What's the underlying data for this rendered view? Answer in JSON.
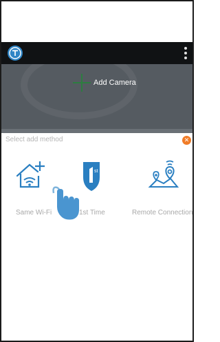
{
  "header": {
    "add_camera_label": "Add Camera"
  },
  "sheet": {
    "title": "Select add method",
    "close_icon": "close-x",
    "methods": [
      {
        "label": "Same Wi-Fi",
        "icon": "home-plus-icon"
      },
      {
        "label": "1st Time",
        "icon": "first-time-icon"
      },
      {
        "label": "Remote Connection",
        "icon": "remote-location-icon"
      }
    ]
  },
  "overlay": {
    "hand": "tap-hand-icon"
  },
  "colors": {
    "accent": "#2a7fc1",
    "close": "#f07c28",
    "dark_bar": "#101214",
    "camera_bg": "#555b61"
  }
}
